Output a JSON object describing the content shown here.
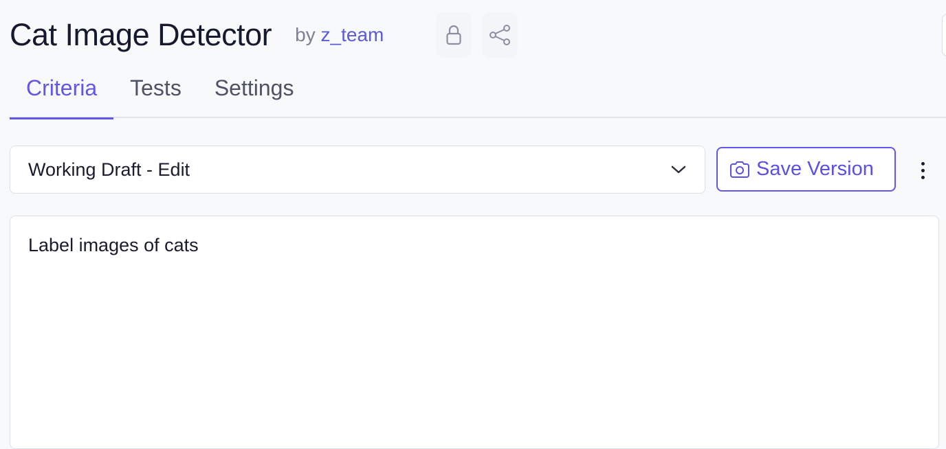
{
  "header": {
    "title": "Cat Image Detector",
    "by_prefix": "by",
    "owner": "z_team",
    "lock_icon": "lock-icon",
    "share_icon": "share-icon"
  },
  "tabs": [
    {
      "label": "Criteria",
      "active": true
    },
    {
      "label": "Tests",
      "active": false
    },
    {
      "label": "Settings",
      "active": false
    }
  ],
  "version_select": {
    "value": "Working Draft - Edit",
    "icon": "chevron-down-icon"
  },
  "save_button": {
    "label": "Save Version",
    "icon": "camera-icon"
  },
  "more_menu": {
    "icon": "more-vertical-icon"
  },
  "editor": {
    "content": "Label images of cats"
  },
  "colors": {
    "accent": "#6156e8",
    "text": "#1a1c2e",
    "muted": "#7d8198",
    "background": "#f8f9fb"
  }
}
